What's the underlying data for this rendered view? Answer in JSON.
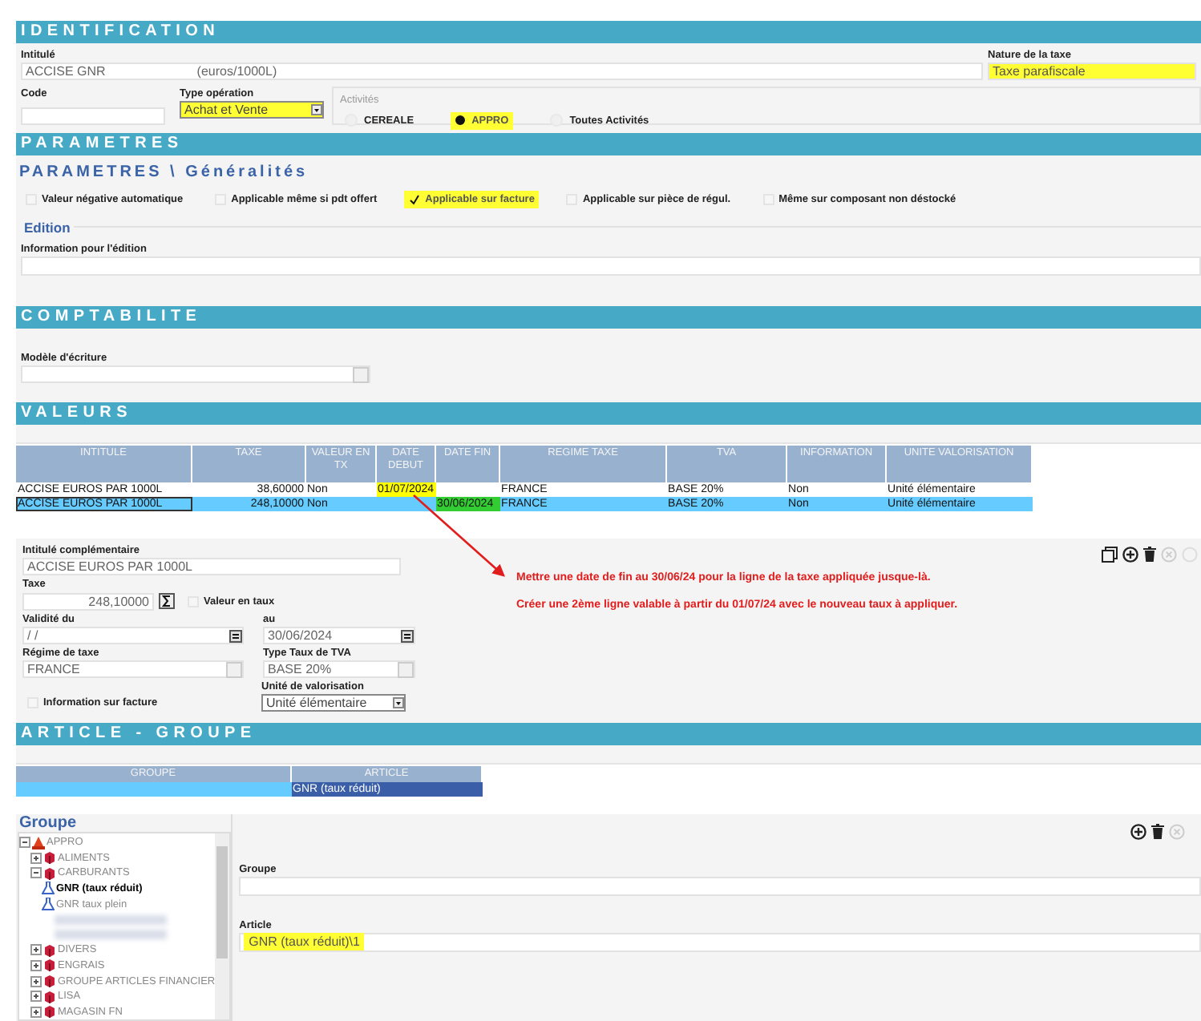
{
  "identification": {
    "title": "IDENTIFICATION",
    "intitule_label": "Intitulé",
    "intitule_value": "ACCISE GNR",
    "intitule_unit": "(euros/1000L)",
    "nature_label": "Nature de la taxe",
    "nature_value": "Taxe parafiscale",
    "nature_highlighted": true,
    "code_label": "Code",
    "type_label": "Type opération",
    "type_value": "Achat et Vente",
    "type_highlighted": true,
    "activites_label": "Activités",
    "activites": [
      {
        "label": "CEREALE",
        "selected": false,
        "highlighted": false
      },
      {
        "label": "APPRO",
        "selected": true,
        "highlighted": true
      },
      {
        "label": "Toutes Activités",
        "selected": false,
        "highlighted": false
      }
    ]
  },
  "parametres": {
    "title": "PARAMETRES",
    "subtitle": "PARAMETRES \\ Généralités",
    "options": [
      {
        "label": "Valeur négative automatique",
        "checked": false,
        "highlighted": false
      },
      {
        "label": "Applicable même si pdt offert",
        "checked": false,
        "highlighted": false
      },
      {
        "label": "Applicable sur facture",
        "checked": true,
        "highlighted": true
      },
      {
        "label": "Applicable sur pièce de régul.",
        "checked": false,
        "highlighted": false
      },
      {
        "label": "Même sur composant non déstocké",
        "checked": false,
        "highlighted": false
      }
    ],
    "edition_legend": "Edition",
    "info_label": "Information pour l'édition"
  },
  "comptabilite": {
    "title": "COMPTABILITE",
    "modele_label": "Modèle d'écriture"
  },
  "valeurs": {
    "title": "VALEURS",
    "table": {
      "columns": [
        "INTITULE",
        "TAXE",
        "VALEUR EN TX",
        "DATE DEBUT",
        "DATE FIN",
        "REGIME TAXE",
        "TVA",
        "INFORMATION",
        "UNITE VALORISATION"
      ],
      "rows": [
        {
          "selected": false,
          "cells": [
            {
              "text": "ACCISE EUROS PAR 1000L"
            },
            {
              "text": "38,60000"
            },
            {
              "text": "Non"
            },
            {
              "text": "01/07/2024",
              "color": "#ffff00"
            },
            {},
            {
              "text": "FRANCE"
            },
            {
              "text": "BASE 20%"
            },
            {
              "text": "Non"
            },
            {
              "text": "Unité élémentaire"
            }
          ]
        },
        {
          "selected": true,
          "cells": [
            {
              "text": "ACCISE EUROS PAR 1000L"
            },
            {
              "text": "248,10000"
            },
            {
              "text": "Non"
            },
            {},
            {
              "text": "30/06/2024",
              "color": "#33cc33"
            },
            {
              "text": "FRANCE"
            },
            {
              "text": "BASE 20%"
            },
            {
              "text": "Non"
            },
            {
              "text": "Unité élémentaire"
            }
          ]
        }
      ]
    },
    "detail": {
      "intitule_label": "Intitulé  complémentaire",
      "intitule_value": "ACCISE EUROS PAR 1000L",
      "taxe_label": "Taxe",
      "taxe_value": "248,10000",
      "valeur_taux_label": "Valeur en taux",
      "valeur_taux_checked": false,
      "validite_label": "Validité du",
      "validite_value": "/ /",
      "au_label": "au",
      "au_value": "30/06/2024",
      "regime_label": "Régime de taxe",
      "regime_value": "FRANCE",
      "tva_label": "Type Taux de TVA",
      "tva_value": "BASE 20%",
      "unite_label": "Unité de valorisation",
      "unite_value": "Unité élémentaire",
      "info_label": "Information sur facture",
      "info_checked": false
    },
    "annotation": [
      "Mettre une date de fin au 30/06/24 pour la ligne de la taxe appliquée jusque-là.",
      "Créer une 2ème ligne valable à partir du 01/07/24 avec le nouveau taux à appliquer."
    ]
  },
  "article_groupe": {
    "title": "ARTICLE - GROUPE",
    "table": {
      "columns": [
        "GROUPE",
        "ARTICLE"
      ],
      "rows": [
        {
          "selected": true,
          "cells": [
            {},
            {
              "text": "GNR  (taux réduit)"
            }
          ]
        }
      ]
    },
    "groupe_legend": "Groupe",
    "tree": [
      {
        "label": "APPRO",
        "kind": "root",
        "expanded": true,
        "selected": false,
        "children": [
          {
            "label": "ALIMENTS",
            "kind": "folder",
            "expanded": false,
            "selected": false
          },
          {
            "label": "CARBURANTS",
            "kind": "folder",
            "expanded": true,
            "selected": false,
            "children": [
              {
                "label": "GNR  (taux réduit)",
                "kind": "article",
                "selected": true
              },
              {
                "label": "GNR    taux plein",
                "kind": "article",
                "selected": false
              },
              {
                "kind": "blurred"
              },
              {
                "kind": "blurred"
              }
            ]
          },
          {
            "label": "DIVERS",
            "kind": "folder",
            "expanded": false,
            "selected": false
          },
          {
            "label": "ENGRAIS",
            "kind": "folder",
            "expanded": false,
            "selected": false
          },
          {
            "label": "GROUPE ARTICLES FINANCIER",
            "kind": "folder",
            "expanded": false,
            "selected": false
          },
          {
            "label": "LISA",
            "kind": "folder",
            "expanded": false,
            "selected": false
          },
          {
            "label": "MAGASIN FN",
            "kind": "folder",
            "expanded": false,
            "selected": false
          }
        ]
      }
    ],
    "groupe_label": "Groupe",
    "article_label": "Article",
    "article_value": "GNR  (taux réduit)\\1",
    "article_highlighted": true
  }
}
